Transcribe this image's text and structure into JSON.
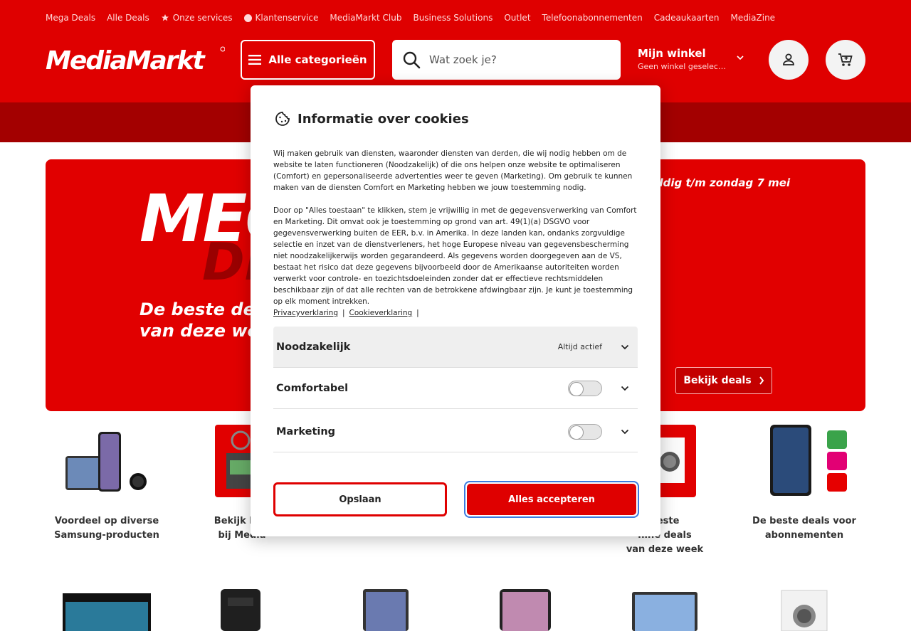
{
  "topnav": [
    {
      "label": "Mega Deals",
      "icon": ""
    },
    {
      "label": "Alle Deals",
      "icon": ""
    },
    {
      "label": "Onze services",
      "icon": "star-icon"
    },
    {
      "label": "Klantenservice",
      "icon": "info-dot-icon"
    },
    {
      "label": "MediaMarkt Club",
      "icon": ""
    },
    {
      "label": "Business Solutions",
      "icon": ""
    },
    {
      "label": "Outlet",
      "icon": ""
    },
    {
      "label": "Telefoonabonnementen",
      "icon": ""
    },
    {
      "label": "Cadeaukaarten",
      "icon": ""
    },
    {
      "label": "MediaZine",
      "icon": ""
    }
  ],
  "header": {
    "logo_text": "MediaMarkt",
    "categories_label": "Alle categorieën",
    "search_placeholder": "Wat zoek je?",
    "store_title": "Mijn winkel",
    "store_subtitle": "Geen winkel geselecteerd",
    "colors": {
      "brand": "#df0000",
      "band": "#a30000"
    }
  },
  "hero": {
    "headline_1": "MEGA",
    "headline_2": "DEALS",
    "subline_1": "De beste deals",
    "subline_2": "van deze week",
    "validity": "Geldig t/m zondag 7 mei",
    "cta_label": "Bekijk deals"
  },
  "tiles": [
    {
      "label_1": "Voordeel op diverse",
      "label_2": "Samsung-producten",
      "label_3": ""
    },
    {
      "label_1": "Bekijk hier",
      "label_2": "bij Media",
      "label_3": ""
    },
    {
      "label_1": "beste",
      "label_2": "hine deals",
      "label_3": "van deze week"
    },
    {
      "label_1": "De beste deals voor",
      "label_2": "abonnementen",
      "label_3": ""
    }
  ],
  "cookie": {
    "title": "Informatie over cookies",
    "paragraph_1": "Wij maken gebruik van diensten, waaronder diensten van derden, die wij nodig hebben om de website te laten functioneren (Noodzakelijk) of die ons helpen onze website te optimaliseren (Comfort) en gepersonaliseerde advertenties weer te geven (Marketing). Om gebruik te kunnen maken van de diensten Comfort en Marketing hebben we jouw toestemming nodig.",
    "paragraph_2": "Door op \"Alles toestaan\" te klikken, stem je vrijwillig in met de gegevensverwerking van Comfort en Marketing. Dit omvat ook je toestemming op grond van art. 49(1)(a) DSGVO voor gegevensverwerking buiten de EER, b.v. in Amerika. In deze landen kan, ondanks zorgvuldige selectie en inzet van de dienstverleners, het hoge Europese niveau van gegevensbescherming niet noodzakelijkerwijs worden gegarandeerd. Als gegevens worden doorgegeven aan de VS, bestaat het risico dat deze gegevens bijvoorbeeld door de Amerikaanse autoriteiten worden verwerkt voor controle- en toezichtsdoeleinden zonder dat er effectieve rechtsmiddelen beschikbaar zijn of dat alle rechten van de betrokkene afdwingbaar zijn. Je kunt je toestemming op elk moment intrekken.",
    "link_privacy": "Privacyverklaring",
    "link_cookie": "Cookieverklaring",
    "separator": "|",
    "sections": [
      {
        "label": "Noodzakelijk",
        "status": "Altijd actief"
      },
      {
        "label": "Comfortabel",
        "status": ""
      },
      {
        "label": "Marketing",
        "status": ""
      }
    ],
    "toggles": {
      "comfort": false,
      "marketing": false
    },
    "save_label": "Opslaan",
    "accept_label": "Alles accepteren"
  }
}
